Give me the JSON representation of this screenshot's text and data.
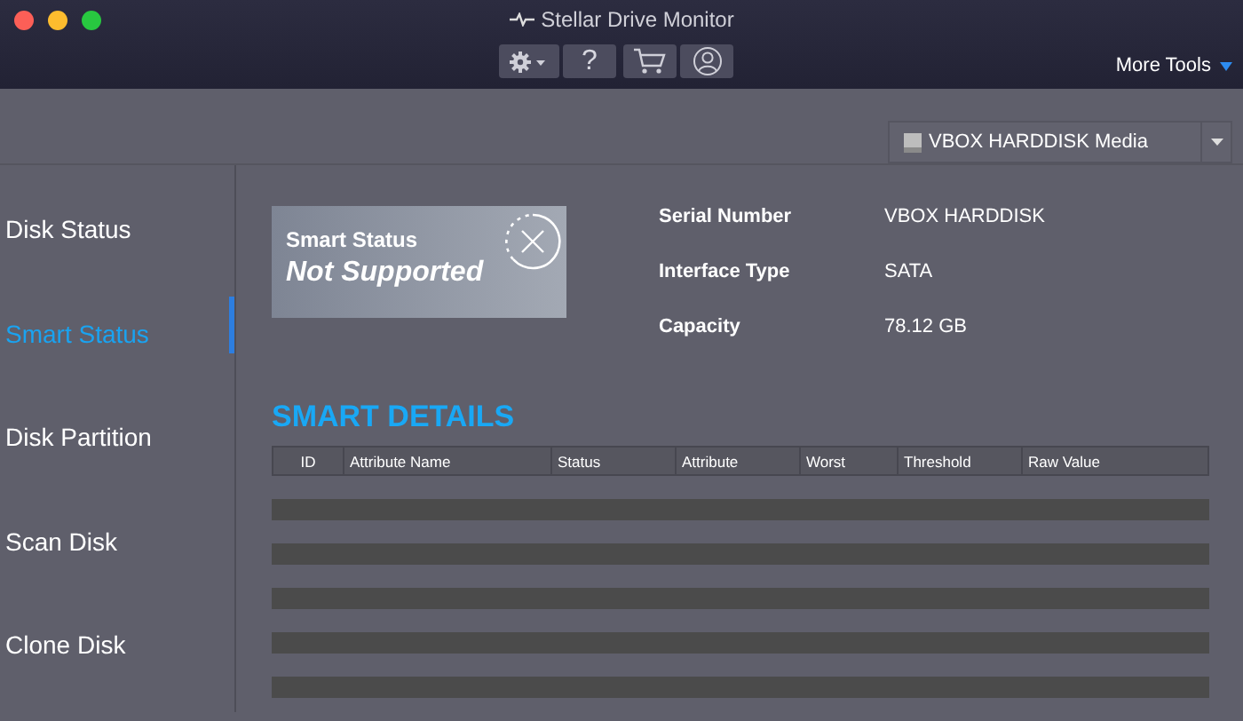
{
  "window": {
    "title": "Stellar Drive Monitor"
  },
  "toolbar": [
    {
      "kind": "settings"
    },
    {
      "kind": "help",
      "label": "?"
    },
    {
      "kind": "cart"
    },
    {
      "kind": "account"
    }
  ],
  "more_tools": "More Tools",
  "drive_selector": {
    "value": "VBOX HARDDISK Media"
  },
  "sidebar": {
    "items": [
      {
        "label": "Disk Status",
        "selected": false
      },
      {
        "label": "Smart Status",
        "selected": true
      },
      {
        "label": "Disk Partition",
        "selected": false
      },
      {
        "label": "Scan Disk",
        "selected": false
      },
      {
        "label": "Clone Disk",
        "selected": false
      }
    ]
  },
  "status_card": {
    "title": "Smart Status",
    "value": "Not Supported"
  },
  "details": [
    {
      "label": "Serial Number",
      "value": "VBOX HARDDISK"
    },
    {
      "label": "Interface Type",
      "value": "SATA"
    },
    {
      "label": "Capacity",
      "value": "78.12 GB"
    }
  ],
  "table": {
    "title": "SMART DETAILS",
    "columns": [
      "ID",
      "Attribute Name",
      "Status",
      "Attribute",
      "Worst",
      "Threshold",
      "Raw Value"
    ]
  }
}
